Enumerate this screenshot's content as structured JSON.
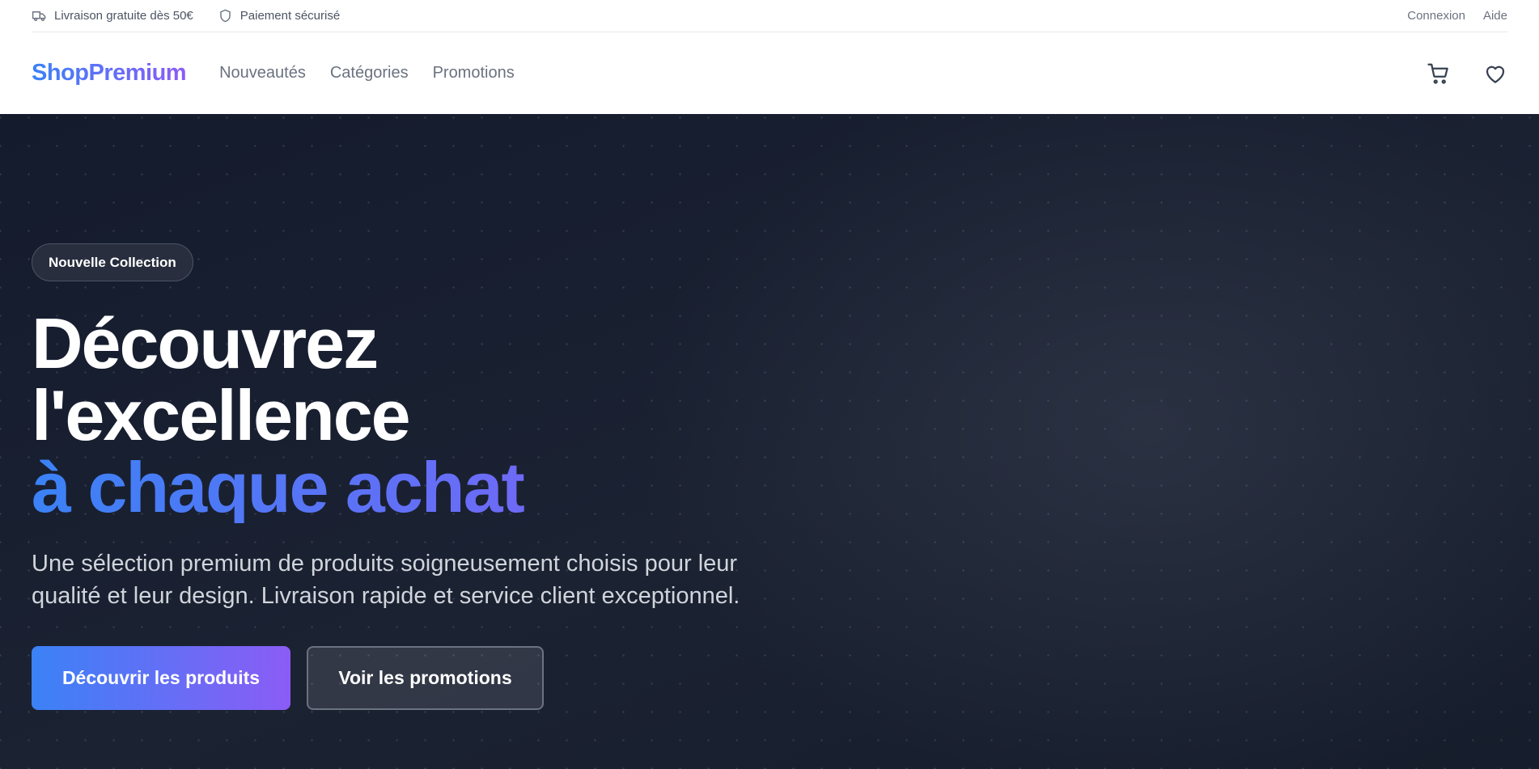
{
  "topbar": {
    "shipping": {
      "icon": "truck-icon",
      "text": "Livraison gratuite dès 50€"
    },
    "payment": {
      "icon": "shield-icon",
      "text": "Paiement sécurisé"
    },
    "links": {
      "login": "Connexion",
      "help": "Aide"
    }
  },
  "header": {
    "logo": "ShopPremium",
    "nav": [
      {
        "label": "Nouveautés"
      },
      {
        "label": "Catégories"
      },
      {
        "label": "Promotions"
      }
    ],
    "actions": {
      "cart_icon": "cart-icon",
      "wishlist_icon": "heart-icon"
    }
  },
  "hero": {
    "badge": "Nouvelle Collection",
    "headline_line1": "Découvrez",
    "headline_line2": "l'excellence",
    "headline_accent": "à chaque achat",
    "lead": "Une sélection premium de produits soigneusement choisis pour leur qualité et leur design. Livraison rapide et service client exceptionnel.",
    "primary_cta": "Découvrir les produits",
    "secondary_cta": "Voir les promotions"
  },
  "colors": {
    "brand_gradient_start": "#3b82f6",
    "brand_gradient_end": "#8b5cf6",
    "hero_background": "#1b2232",
    "text_muted": "#6b7280"
  }
}
